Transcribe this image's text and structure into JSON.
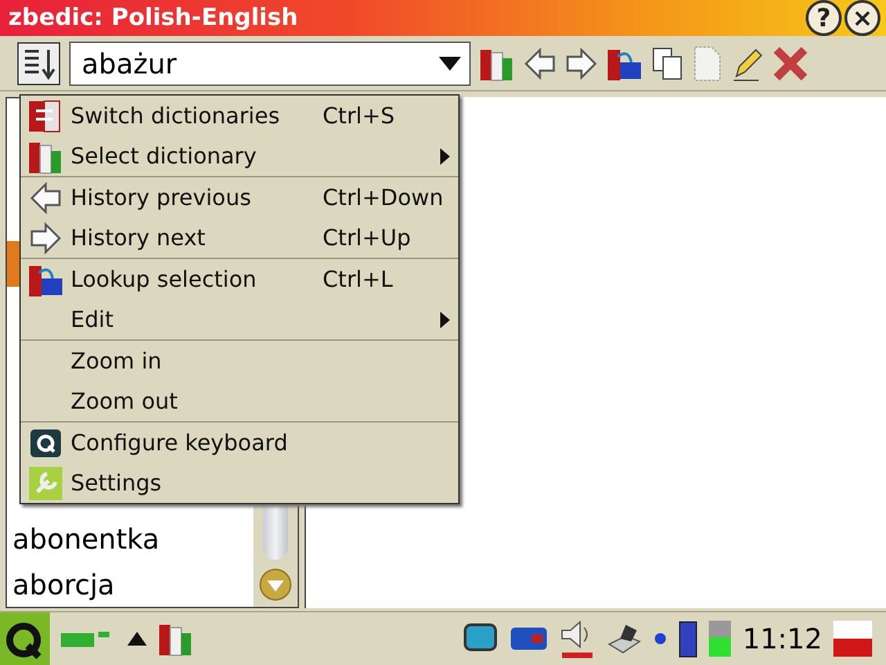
{
  "window": {
    "title": "zbedic: Polish-English",
    "buttons": [
      "?",
      "×"
    ]
  },
  "search": {
    "value": "abażur"
  },
  "word_list": {
    "rows": [
      {
        "selected": false
      },
      {
        "selected": false
      },
      {
        "selected": false
      },
      {
        "selected": true
      },
      {
        "selected": false
      },
      {
        "selected": false
      },
      {
        "selected": false
      },
      {
        "selected": false
      },
      {
        "selected": false
      },
      {
        "text": "abonentka",
        "selected": false
      },
      {
        "text": "aborcja",
        "selected": false
      }
    ]
  },
  "menu": {
    "groups": [
      [
        {
          "label": "Switch dictionaries",
          "shortcut": "Ctrl+S",
          "submenu": false,
          "kind": "switch"
        },
        {
          "label": "Select dictionary",
          "submenu": true,
          "kind": "books"
        }
      ],
      [
        {
          "label": "History previous",
          "shortcut": "Ctrl+Down",
          "submenu": false,
          "kind": "back"
        },
        {
          "label": "History next",
          "shortcut": "Ctrl+Up",
          "submenu": false,
          "kind": "forward"
        }
      ],
      [
        {
          "label": "Lookup selection",
          "shortcut": "Ctrl+L",
          "submenu": false,
          "kind": "lookup"
        },
        {
          "label": "Edit",
          "submenu": true,
          "kind": "plain"
        }
      ],
      [
        {
          "label": "Zoom in",
          "submenu": false,
          "kind": "plain"
        },
        {
          "label": "Zoom out",
          "submenu": false,
          "kind": "plain"
        }
      ],
      [
        {
          "label": "Configure keyboard",
          "submenu": false,
          "kind": "keyboard"
        },
        {
          "label": "Settings",
          "submenu": false,
          "kind": "settings"
        }
      ]
    ]
  },
  "taskbar": {
    "clock": "11:12"
  }
}
